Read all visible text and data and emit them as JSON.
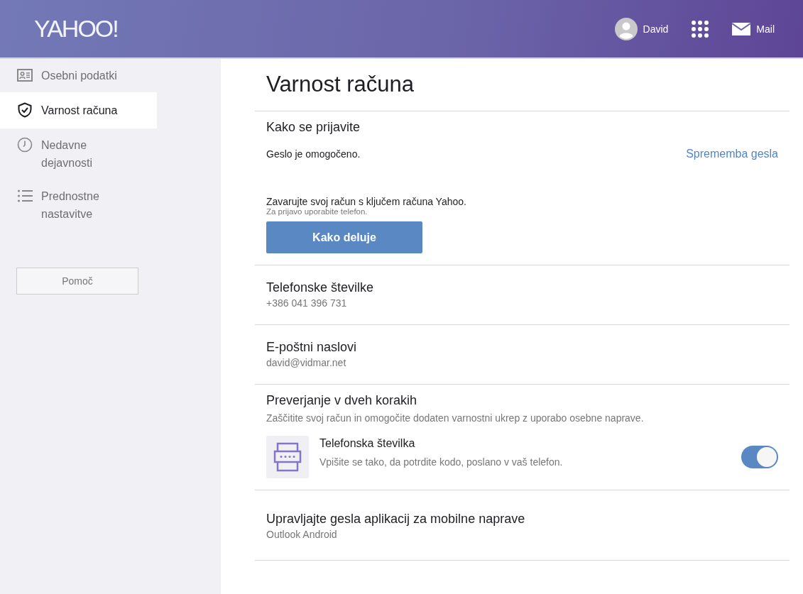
{
  "header": {
    "logo": "YAHOO!",
    "user": "David",
    "mail": "Mail"
  },
  "sidebar": {
    "items": [
      {
        "label": "Osebni podatki",
        "selected": false
      },
      {
        "label": "Varnost računa",
        "selected": true
      },
      {
        "label": "Nedavne dejavnosti",
        "selected": false
      },
      {
        "label": "Prednostne nastavitve",
        "selected": false
      }
    ],
    "help": "Pomoč"
  },
  "page": {
    "title": "Varnost računa",
    "sections": [
      {
        "kind": "signin",
        "heading": "Kako se prijavite",
        "status": "Geslo je omogočeno.",
        "link": "Sprememba gesla",
        "key_text": "Zavarujte svoj račun s ključem računa Yahoo.",
        "key_hint": "Za prijavo uporabite telefon.",
        "button": "Kako deluje"
      },
      {
        "kind": "info",
        "heading": "Telefonske številke",
        "value": "+386 041 396 731"
      },
      {
        "kind": "info",
        "heading": "E-poštni naslovi",
        "value": "david@vidmar.net"
      },
      {
        "kind": "twostep",
        "heading": "Preverjanje v dveh korakih",
        "description": "Zaščitite svoj račun in omogočite dodaten varnostni ukrep z uporabo osebne naprave.",
        "option_title": "Telefonska številka",
        "option_text": "Vpišite se tako, da potrdite kodo, poslano v vaš telefon.",
        "on": true
      },
      {
        "kind": "info",
        "heading": "Upravljajte gesla aplikacij za mobilne naprave",
        "value": "Outlook Android"
      }
    ]
  }
}
